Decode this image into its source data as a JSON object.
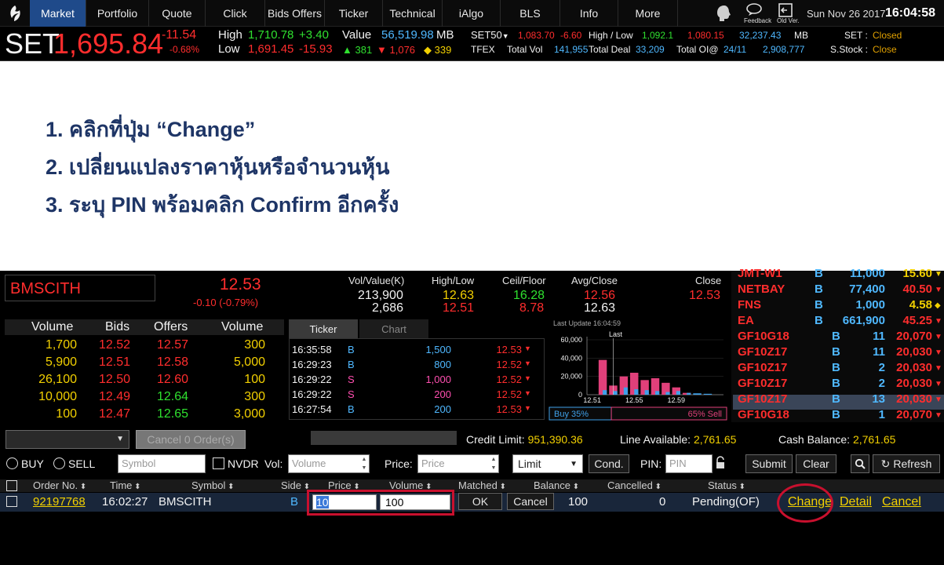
{
  "nav": {
    "items": [
      "Market",
      "Portfolio",
      "Quote",
      "Click",
      "Bids Offers",
      "Ticker",
      "Technical",
      "iAlgo",
      "BLS",
      "Info",
      "More"
    ],
    "feedback": "Feedback",
    "old_ver": "Old Ver.",
    "date": "Sun Nov 26 2017",
    "time": "16:04:58"
  },
  "strip": {
    "index_name": "SET",
    "index_value": "1,695.84",
    "change": "-11.54",
    "change_pct": "-0.68%",
    "high_label": "High",
    "high_value": "1,710.78",
    "high_change": "+3.40",
    "low_label": "Low",
    "low_value": "1,691.45",
    "low_change": "-15.93",
    "value_label": "Value",
    "value_amount": "56,519.98",
    "value_unit": "MB",
    "up_count": "381",
    "down_count": "1,076",
    "unch_count": "339",
    "set50_label": "SET50",
    "set50_value": "1,083.70",
    "set50_change": "-6.60",
    "hl_label": "High / Low",
    "hl_high": "1,092.1",
    "hl_low": "1,080.15",
    "set50_amount": "32,237.43",
    "set50_unit": "MB",
    "tfex_label": "TFEX",
    "total_vol_label": "Total Vol",
    "total_vol": "141,955",
    "total_deal_label": "Total Deal",
    "total_deal": "33,209",
    "total_oi_label": "Total OI@",
    "total_oi_date": "24/11",
    "total_oi": "2,908,777",
    "set_status_label": "SET :",
    "set_status": "Closed",
    "sstock_label": "S.Stock :",
    "sstock_status": "Close"
  },
  "steps": [
    "1. คลิกที่ปุ่ม “Change”",
    "2. เปลี่ยนแปลงราคาหุ้นหรือจำนวนหุ้น",
    "3. ระบุ PIN พร้อมคลิก Confirm อีกครั้ง"
  ],
  "quote": {
    "symbol": "BMSCITH",
    "last": "12.53",
    "change": "-0.10 (-0.79%)",
    "vol_value_label": "Vol/Value(K)",
    "vol": "213,900",
    "value": "2,686",
    "hl_label": "High/Low",
    "high": "12.63",
    "low": "12.51",
    "ceil_floor_label": "Ceil/Floor",
    "ceil": "16.28",
    "floor": "8.78",
    "avg_close_label": "Avg/Close",
    "avg": "12.56",
    "prev_close": "12.63",
    "close_label": "Close",
    "close": "12.53"
  },
  "bidoffer": {
    "headers": [
      "Volume",
      "Bids",
      "Offers",
      "Volume"
    ],
    "rows": [
      [
        "1,700",
        "12.52",
        "12.57",
        "300"
      ],
      [
        "5,900",
        "12.51",
        "12.58",
        "5,000"
      ],
      [
        "26,100",
        "12.50",
        "12.60",
        "100"
      ],
      [
        "10,000",
        "12.49",
        "12.64",
        "300"
      ],
      [
        "100",
        "12.47",
        "12.65",
        "3,000"
      ]
    ]
  },
  "ticker": {
    "tab_ticker": "Ticker",
    "tab_chart": "Chart",
    "rows": [
      [
        "16:35:58",
        "B",
        "1,500",
        "12.53"
      ],
      [
        "16:29:23",
        "B",
        "800",
        "12.52"
      ],
      [
        "16:29:22",
        "S",
        "1,000",
        "12.52"
      ],
      [
        "16:29:22",
        "S",
        "200",
        "12.52"
      ],
      [
        "16:27:54",
        "B",
        "200",
        "12.53"
      ]
    ]
  },
  "chart_data": {
    "type": "bar",
    "title": "Last Update 16:04:59",
    "last_label": "Last",
    "y_ticks": [
      "60,000",
      "40,000",
      "20,000",
      "0"
    ],
    "x_ticks": [
      "12.51",
      "12.55",
      "12.59"
    ],
    "ylim": [
      0,
      60000
    ],
    "categories": [
      "12.51",
      "12.52",
      "12.53",
      "12.54",
      "12.55",
      "12.56",
      "12.57",
      "12.58",
      "12.59",
      "12.60",
      "12.61",
      "12.62",
      "12.63"
    ],
    "series": [
      {
        "values": [
          0,
          5000,
          4000,
          8000,
          6000,
          5000,
          4000,
          3000,
          4000,
          2000,
          1500,
          1000,
          0
        ]
      },
      {
        "values": [
          0,
          38000,
          10000,
          20000,
          24000,
          16000,
          18000,
          13000,
          8000,
          2000,
          0,
          0,
          0
        ]
      }
    ],
    "buy_label": "Buy 35%",
    "sell_label": "65% Sell",
    "buy_pct": 35
  },
  "marketlist": {
    "rows": [
      [
        "JMT-W1",
        "B",
        "11,000",
        "15.60"
      ],
      [
        "NETBAY",
        "B",
        "77,400",
        "40.50"
      ],
      [
        "FNS",
        "B",
        "1,000",
        "4.58"
      ],
      [
        "EA",
        "B",
        "661,900",
        "45.25"
      ],
      [
        "GF10G18",
        "B",
        "11",
        "20,070"
      ],
      [
        "GF10Z17",
        "B",
        "11",
        "20,030"
      ],
      [
        "GF10Z17",
        "B",
        "2",
        "20,030"
      ],
      [
        "GF10Z17",
        "B",
        "2",
        "20,030"
      ],
      [
        "GF10Z17",
        "B",
        "13",
        "20,030"
      ],
      [
        "GF10G18",
        "B",
        "1",
        "20,070"
      ]
    ]
  },
  "account": {
    "cancel_orders": "Cancel 0 Order(s)",
    "credit_label": "Credit Limit:",
    "credit": "951,390.36",
    "line_label": "Line Available:",
    "line": "2,761.65",
    "cash_label": "Cash Balance:",
    "cash": "2,761.65"
  },
  "order_form": {
    "buy": "BUY",
    "sell": "SELL",
    "symbol_ph": "Symbol",
    "nvdr": "NVDR",
    "vol_label": "Vol:",
    "vol_ph": "Volume",
    "price_label": "Price:",
    "price_ph": "Price",
    "type": "Limit",
    "cond": "Cond.",
    "pin_label": "PIN:",
    "pin_ph": "PIN",
    "submit": "Submit",
    "clear": "Clear",
    "refresh": "Refresh"
  },
  "orders": {
    "headers": [
      "Order No.",
      "Time",
      "Symbol",
      "Side",
      "Price",
      "Volume",
      "Matched",
      "Balance",
      "Cancelled",
      "Status"
    ],
    "row": {
      "order_no": "92197768",
      "time": "16:02:27",
      "symbol": "BMSCITH",
      "side": "B",
      "price": "10",
      "volume": "100",
      "ok": "OK",
      "cancel_btn": "Cancel",
      "balance": "100",
      "cancelled": "0",
      "status": "Pending(OF)",
      "change": "Change",
      "detail": "Detail",
      "cancel_link": "Cancel"
    }
  }
}
